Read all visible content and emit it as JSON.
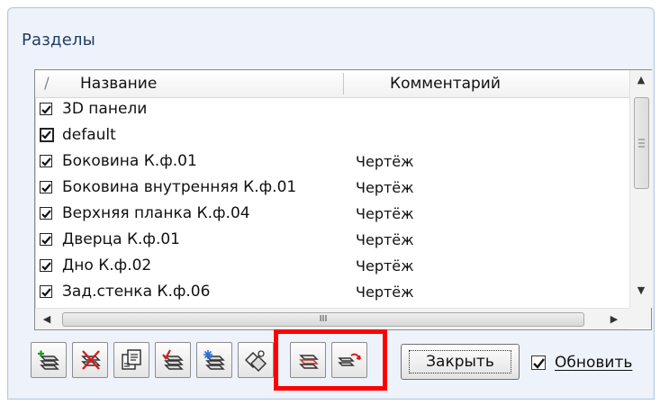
{
  "window": {
    "title": "Разделы"
  },
  "list": {
    "columns": {
      "sort_glyph": "/",
      "name": "Название",
      "comment": "Комментарий"
    },
    "rows": [
      {
        "name": "3D панели",
        "comment": ""
      },
      {
        "name": "default",
        "comment": ""
      },
      {
        "name": "Боковина К.ф.01",
        "comment": "Чертёж"
      },
      {
        "name": "Боковина внутренняя К.ф.01",
        "comment": "Чертёж"
      },
      {
        "name": "Верхняя планка К.ф.04",
        "comment": "Чертёж"
      },
      {
        "name": "Дверца К.ф.01",
        "comment": "Чертёж"
      },
      {
        "name": "Дно К.ф.02",
        "comment": "Чертёж"
      },
      {
        "name": "Зад.стенка К.ф.06",
        "comment": "Чертёж"
      }
    ],
    "hscroll_grip": "III"
  },
  "toolbar": {
    "buttons": [
      {
        "icon": "add-layer-icon"
      },
      {
        "icon": "delete-layer-icon"
      },
      {
        "icon": "properties-icon"
      },
      {
        "icon": "check-layers-icon"
      },
      {
        "icon": "select-layers-icon"
      },
      {
        "icon": "layers-tool-icon"
      },
      {
        "icon": "layer-stack-icon"
      },
      {
        "icon": "layer-arrow-icon"
      }
    ],
    "close_label": "Закрыть",
    "update_label": "Обновить",
    "update_checked": true
  },
  "colors": {
    "highlight": "#ff0000",
    "title": "#1f3d6b"
  }
}
